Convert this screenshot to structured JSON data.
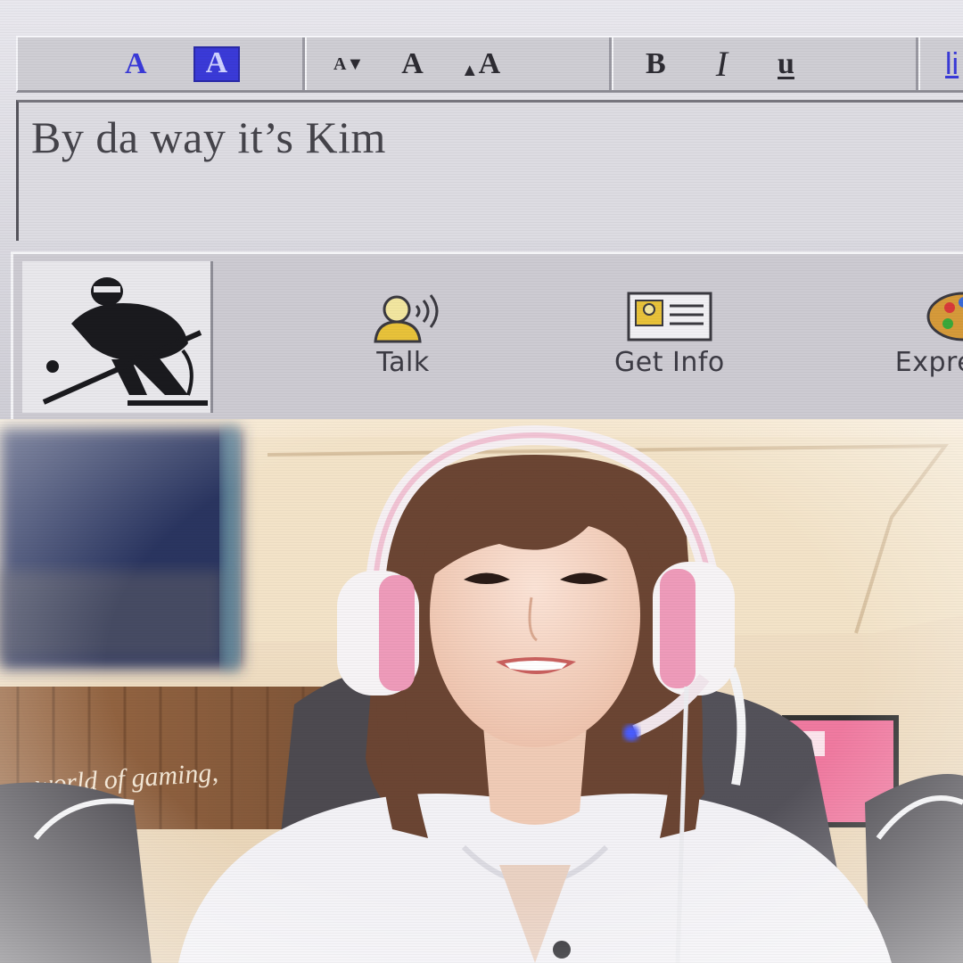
{
  "toolbar": {
    "font_color_glyph": "A",
    "highlight_glyph": "A",
    "smaller_font_glyph": "A",
    "normal_font_glyph": "A",
    "larger_font_glyph": "A",
    "bold_glyph": "B",
    "italic_glyph": "I",
    "underline_glyph": "u",
    "link_glyph": "li"
  },
  "message": {
    "text": "By da way it’s Kim"
  },
  "actions": {
    "talk_label": "Talk",
    "get_info_label": "Get Info",
    "expressions_label": "Expre"
  },
  "icons": {
    "buddy": "hockey-player-icon",
    "talk": "talk-icon",
    "get_info": "id-card-icon",
    "expressions": "palette-icon"
  },
  "colors": {
    "window_gray": "#cdcbd2",
    "accent_blue": "#3a3ad8",
    "text_dark": "#3c3b44"
  },
  "photo": {
    "neon_sign_text": "world of gaming,"
  }
}
